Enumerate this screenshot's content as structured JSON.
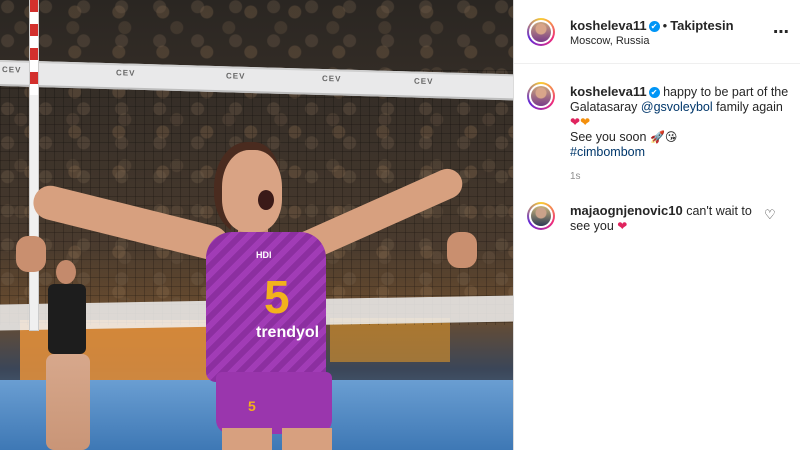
{
  "post": {
    "username": "kosheleva11",
    "verified_mark": "✔",
    "follow_status": "Takiptesin",
    "separator": "•",
    "location": "Moscow, Russia",
    "more_glyph": "⋯"
  },
  "caption": {
    "username": "kosheleva11",
    "text_before": "happy to be part of the Galatasaray",
    "mention": "@gsvoleybol",
    "text_after": "family again",
    "emoji_line1_a": "❤",
    "emoji_line1_b": "❤",
    "line2_text": "See you soon",
    "emoji_line2_a": "🚀",
    "emoji_line2_b": "😘",
    "hashtag": "#cimbombom",
    "timestamp": "1s"
  },
  "comment": {
    "username": "majaognjenovic10",
    "text": "can't wait to see you",
    "emoji": "❤",
    "like_icon": "♡"
  },
  "photo": {
    "jersey_number": "5",
    "sponsor_top": "HDI",
    "sponsor_mid": "trendyol",
    "shorts_number": "5",
    "banner_text": "CEV"
  },
  "colors": {
    "link": "#00376b",
    "verified": "#0095f6",
    "jersey": "#9a36ad",
    "number": "#f2b21b"
  }
}
